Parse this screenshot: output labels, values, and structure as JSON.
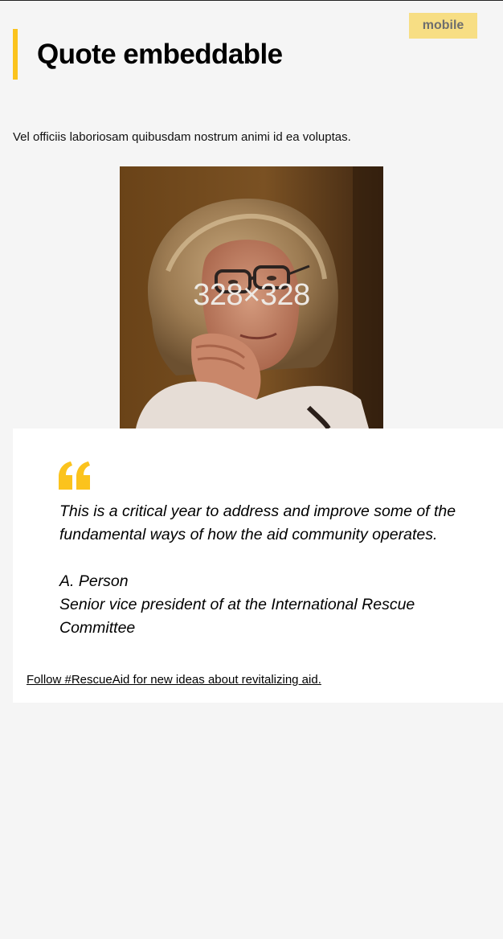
{
  "badge": {
    "label": "mobile"
  },
  "header": {
    "title": "Quote embeddable"
  },
  "intro": {
    "text": "Vel officiis laboriosam quibusdam nostrum animi id ea voluptas."
  },
  "image": {
    "placeholder_label": "328×328"
  },
  "quote": {
    "mark_icon": "quote-mark-icon",
    "text": "This is a critical year to address and improve some of the fundamental ways of how the aid community operates.",
    "author_name": "A. Person",
    "author_title": "Senior vice president of at the International Rescue Committee"
  },
  "follow": {
    "link_text": "Follow #RescueAid for new ideas about revitalizing aid."
  },
  "colors": {
    "accent": "#fbc31d",
    "badge_background": "#f7de84",
    "page_background": "#f5f5f5",
    "card_background": "#ffffff"
  }
}
